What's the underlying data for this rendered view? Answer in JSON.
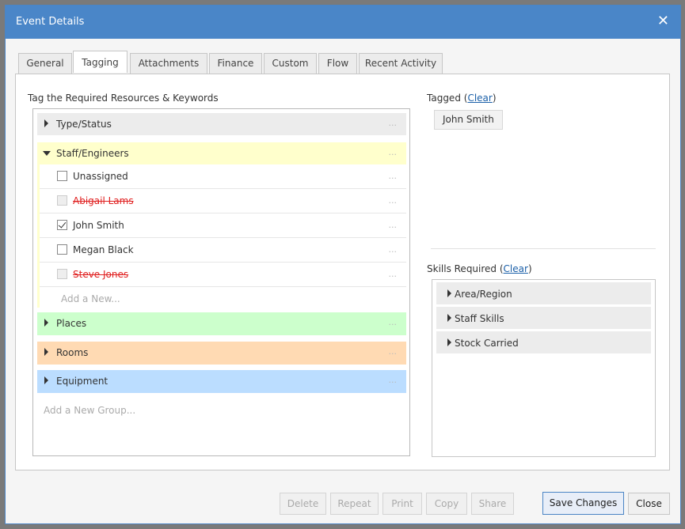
{
  "dialog": {
    "title": "Event Details"
  },
  "tabs": [
    {
      "label": "General"
    },
    {
      "label": "Tagging"
    },
    {
      "label": "Attachments"
    },
    {
      "label": "Finance"
    },
    {
      "label": "Custom"
    },
    {
      "label": "Flow"
    },
    {
      "label": "Recent Activity"
    }
  ],
  "active_tab": "Tagging",
  "left": {
    "heading": "Tag the Required Resources & Keywords",
    "groups": {
      "type_status": "Type/Status",
      "staff": "Staff/Engineers",
      "places": "Places",
      "rooms": "Rooms",
      "equipment": "Equipment"
    },
    "staff_items": [
      {
        "name": "Unassigned",
        "checked": false,
        "disabled": false
      },
      {
        "name": "Abigail Lams",
        "checked": false,
        "disabled": true
      },
      {
        "name": "John Smith",
        "checked": true,
        "disabled": false
      },
      {
        "name": "Megan Black",
        "checked": false,
        "disabled": false
      },
      {
        "name": "Steve Jones",
        "checked": false,
        "disabled": true
      }
    ],
    "add_new": "Add a New...",
    "add_group": "Add a New Group...",
    "dots": "..."
  },
  "right": {
    "tagged_label": "Tagged (",
    "clear": "Clear",
    "close_paren": ")",
    "tagged_items": [
      "John Smith"
    ],
    "skills_label": "Skills Required (",
    "skill_groups": [
      "Area/Region",
      "Staff Skills",
      "Stock Carried"
    ]
  },
  "footer": {
    "delete": "Delete",
    "repeat": "Repeat",
    "print": "Print",
    "copy": "Copy",
    "share": "Share",
    "save": "Save Changes",
    "close": "Close"
  },
  "colors": {
    "titlebar": "#4a86c8",
    "staff_group": "#ffffcc",
    "places_group": "#ccffcc",
    "rooms_group": "#ffdab3",
    "equipment_group": "#bbddff",
    "removed_name": "#e02020"
  }
}
